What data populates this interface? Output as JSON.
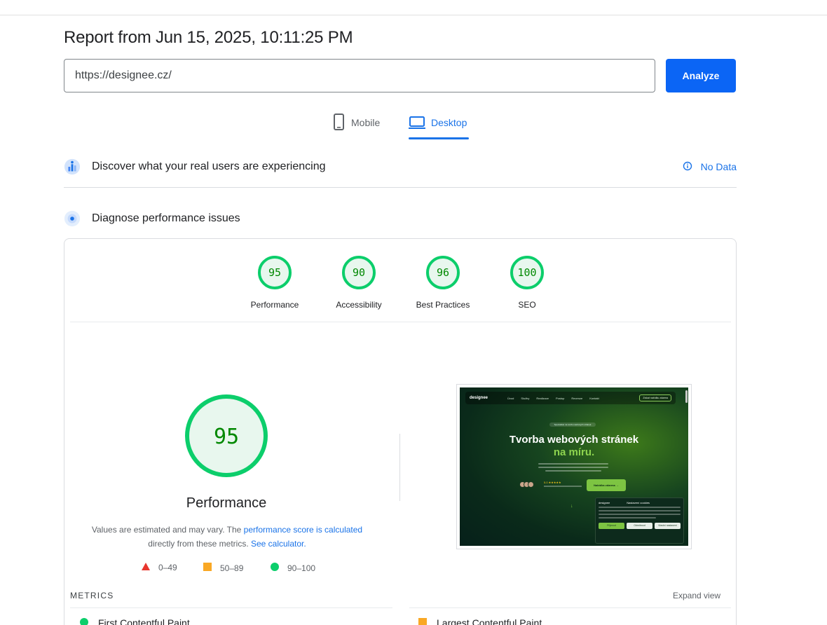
{
  "report": {
    "title": "Report from Jun 15, 2025, 10:11:25 PM",
    "url_value": "https://designee.cz/",
    "analyze_label": "Analyze"
  },
  "tabs": [
    {
      "label": "Mobile",
      "icon": "phone-icon",
      "active": false
    },
    {
      "label": "Desktop",
      "icon": "laptop-icon",
      "active": true
    }
  ],
  "crux": {
    "title": "Discover what your real users are experiencing",
    "status": "No Data",
    "status_icon": "info-icon"
  },
  "diagnose": {
    "title": "Diagnose performance issues"
  },
  "categories": [
    {
      "label": "Performance",
      "score": 95
    },
    {
      "label": "Accessibility",
      "score": 90
    },
    {
      "label": "Best Practices",
      "score": 96
    },
    {
      "label": "SEO",
      "score": 100
    }
  ],
  "main_gauge": {
    "score": 95,
    "title": "Performance",
    "desc_prefix": "Values are estimated and may vary. The ",
    "desc_link1": "performance score is calculated",
    "desc_middle": "directly from these metrics. ",
    "desc_link2": "See calculator."
  },
  "legend": [
    {
      "shape": "triangle",
      "color": "#e8362e",
      "range": "0–49"
    },
    {
      "shape": "square",
      "color": "#f9a825",
      "range": "50–89"
    },
    {
      "shape": "circle",
      "color": "#0cce6b",
      "range": "90–100"
    }
  ],
  "screenshot": {
    "logo": "designee",
    "nav": [
      "Úvod",
      "Služby",
      "Realizace",
      "Postup",
      "Recenze",
      "Kontakt"
    ],
    "cta": "Získat nabídku zdarma",
    "badge": "Specialisté na tvorbu webových stránek",
    "headline1": "Tvorba webových stránek",
    "headline2": "na míru.",
    "rating": "5.0 ★★★★★",
    "button": "Nabídka zdarma →",
    "cookie_logo": "designee",
    "cookie_title": "Nastavení cookies",
    "cookie_buttons": [
      "Přijmout",
      "Odmítnout",
      "Vlastní nastavení"
    ]
  },
  "metrics": {
    "label": "METRICS",
    "expand": "Expand view",
    "items": [
      {
        "name": "First Contentful Paint",
        "rating": "pass"
      },
      {
        "name": "Largest Contentful Paint",
        "rating": "average"
      }
    ]
  },
  "colors": {
    "pass": "#0cce6b",
    "pass_text": "#008800",
    "pass_bg": "#e8f7ee",
    "average": "#f9a825",
    "fail": "#e8362e",
    "accent": "#1a73e8",
    "button": "#0b65f5"
  }
}
